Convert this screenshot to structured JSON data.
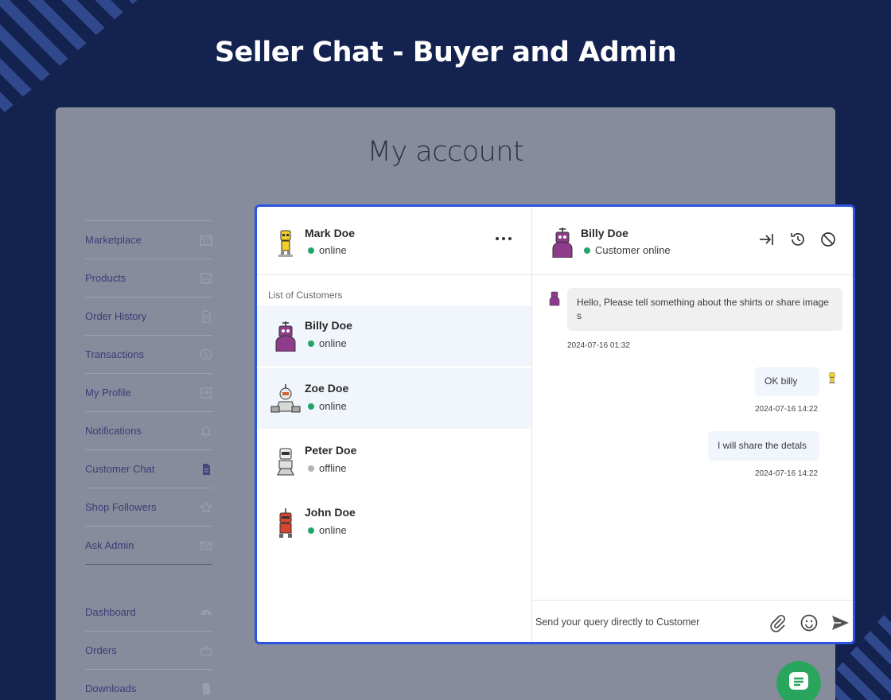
{
  "hero": {
    "title": "Seller Chat - Buyer and Admin"
  },
  "account": {
    "title": "My account",
    "menu": [
      {
        "label": "Marketplace",
        "icon": "marketplace-icon"
      },
      {
        "label": "Products",
        "icon": "save-icon"
      },
      {
        "label": "Order History",
        "icon": "document-icon"
      },
      {
        "label": "Transactions",
        "icon": "dollar-icon"
      },
      {
        "label": "My Profile",
        "icon": "profile-icon"
      },
      {
        "label": "Notifications",
        "icon": "bell-icon"
      },
      {
        "label": "Customer Chat",
        "icon": "file-icon"
      },
      {
        "label": "Shop Followers",
        "icon": "star-icon"
      },
      {
        "label": "Ask Admin",
        "icon": "mail-icon"
      }
    ],
    "menu2": [
      {
        "label": "Dashboard",
        "icon": "gauge-icon"
      },
      {
        "label": "Orders",
        "icon": "basket-icon"
      },
      {
        "label": "Downloads",
        "icon": "file-icon"
      }
    ]
  },
  "chat": {
    "me": {
      "name": "Mark Doe",
      "status": "online"
    },
    "list_label": "List of Customers",
    "customers": [
      {
        "name": "Billy Doe",
        "status": "online"
      },
      {
        "name": "Zoe Doe",
        "status": "online"
      },
      {
        "name": "Peter Doe",
        "status": "offline"
      },
      {
        "name": "John Doe",
        "status": "online"
      }
    ],
    "active": {
      "name": "Billy Doe",
      "status": "Customer online"
    },
    "messages": [
      {
        "from": "customer",
        "text": "Hello, Please tell something about the shirts or share images",
        "time": "2024-07-16 01:32"
      },
      {
        "from": "me",
        "text": "OK billy",
        "time": "2024-07-16 14:22"
      },
      {
        "from": "me",
        "text": "I will share the detals",
        "time": "2024-07-16 14:22"
      }
    ],
    "composer_placeholder": "Send your query directly to Customer"
  },
  "colors": {
    "brand_bg": "#13224f",
    "chat_border": "#2c55e0",
    "online": "#23a46a",
    "fab": "#2aa55d"
  }
}
